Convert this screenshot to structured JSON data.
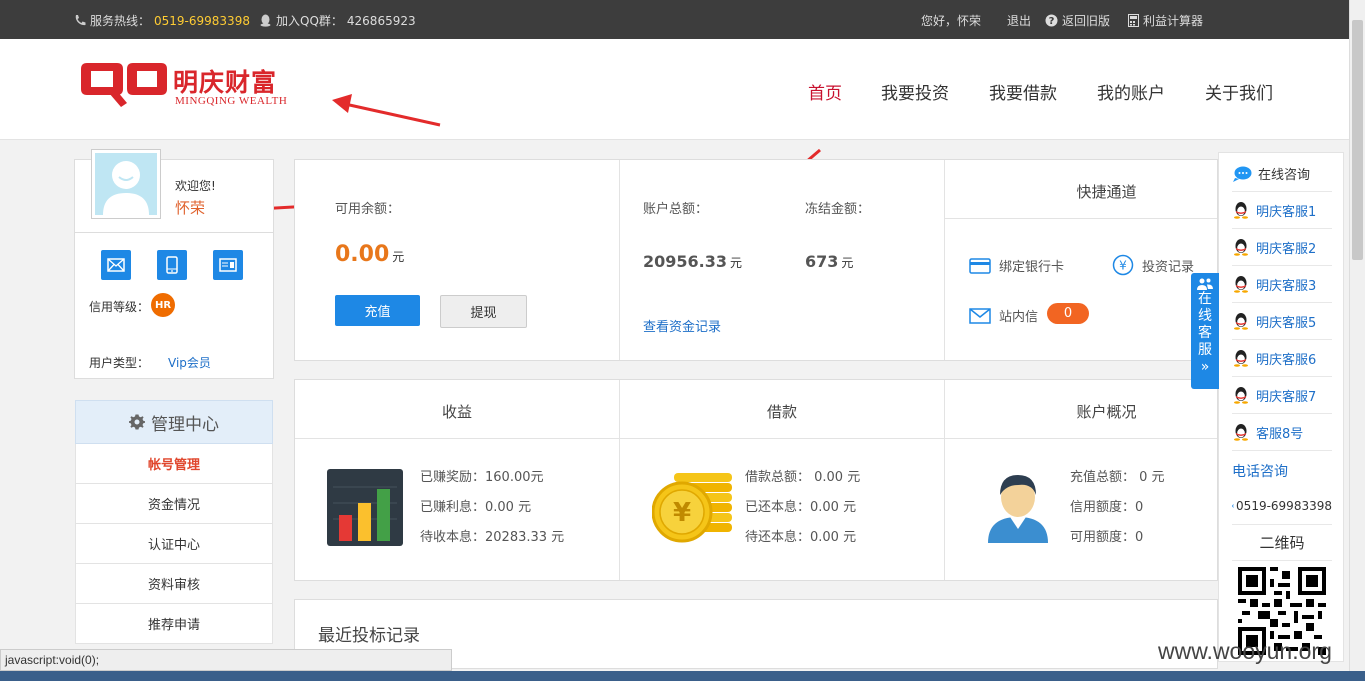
{
  "topbar": {
    "hotline_label": "服务热线：",
    "hotline_number": "0519-69983398",
    "qq_label": "加入QQ群：",
    "qq_number": "426865923",
    "greeting": "您好，怀荣",
    "logout": "退出",
    "old_version": "返回旧版",
    "calculator": "利益计算器"
  },
  "logo": {
    "cn": "明庆财富",
    "en": "MINGQING WEALTH"
  },
  "nav": [
    "首页",
    "我要投资",
    "我要借款",
    "我的账户",
    "关于我们"
  ],
  "profile": {
    "welcome": "欢迎您!",
    "username": "怀荣",
    "credit_label": "信用等级：",
    "credit_badge": "HR",
    "user_type_label": "用户类型：",
    "user_type": "Vip会员"
  },
  "menu": {
    "title": "管理中心",
    "items": [
      "帐号管理",
      "资金情况",
      "认证中心",
      "资料审核",
      "推荐申请"
    ]
  },
  "balance": {
    "available_label": "可用余额：",
    "available_value": "0.00",
    "unit": "元",
    "recharge": "充值",
    "withdraw": "提现",
    "total_label": "账户总额：",
    "total_value": "20956.33",
    "frozen_label": "冻结金额：",
    "frozen_value": "673",
    "fund_records": "查看资金记录"
  },
  "quick": {
    "title": "快捷通道",
    "bind_card": "绑定银行卡",
    "invest_records": "投资记录",
    "messages": "站内信",
    "message_count": "0"
  },
  "sections": {
    "income": {
      "title": "收益",
      "earned_reward": "已赚奖励：160.00元",
      "earned_interest": "已赚利息：0.00 元",
      "pending_principal": "待收本息：20283.33 元"
    },
    "loan": {
      "title": "借款",
      "total": "借款总额： 0.00 元",
      "repaid": "已还本息：0.00 元",
      "pending": "待还本息：0.00 元"
    },
    "overview": {
      "title": "账户概况",
      "recharge_total": "充值总额： 0 元",
      "credit_limit": "信用额度：0",
      "available_limit": "可用额度：0"
    }
  },
  "recent_title": "最近投标记录",
  "service": {
    "online": "在线咨询",
    "agents": [
      "明庆客服1",
      "明庆客服2",
      "明庆客服3",
      "明庆客服5",
      "明庆客服6",
      "明庆客服7",
      "客服8号"
    ],
    "phone_title": "电话咨询",
    "phone": "0519-69983398",
    "qr_title": "二维码",
    "tab": [
      "在",
      "线",
      "客",
      "服"
    ]
  },
  "status_bar": "javascript:void(0);",
  "watermark": "www.wooyun.org",
  "colors": {
    "brand_red": "#d9262b",
    "accent_blue": "#1e88e5",
    "orange": "#e8771b"
  }
}
